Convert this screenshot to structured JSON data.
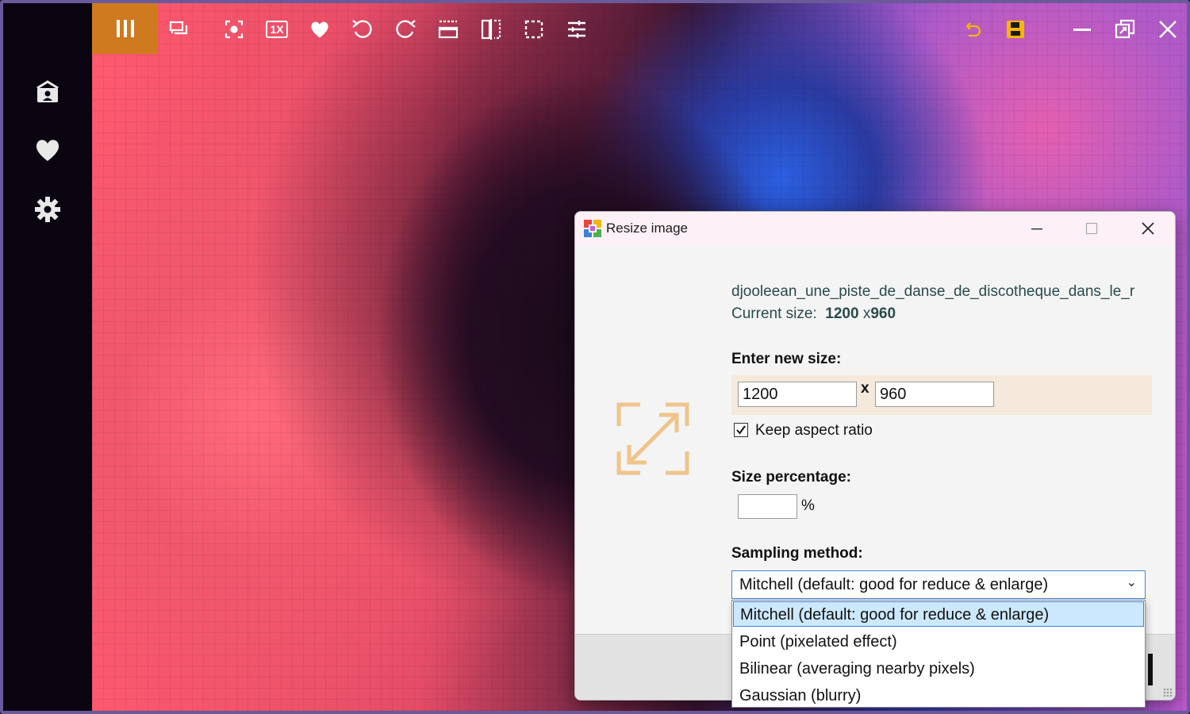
{
  "window": {
    "sidebar": {
      "items": [
        "contacts-card-icon",
        "heart-icon",
        "gear-icon"
      ]
    },
    "toolbar": {
      "menu_icon": "bars-icon",
      "zoom_label": "1X",
      "icons": [
        "chat-icon",
        "focus-icon",
        "1x-icon",
        "heart-icon",
        "rotate-left-icon",
        "rotate-right-icon",
        "flip-vertical-icon",
        "flip-horizontal-icon",
        "crop-icon",
        "adjust-icon"
      ],
      "right_icons": [
        "undo-icon",
        "save-icon",
        "minimize-icon",
        "restore-icon",
        "close-icon"
      ],
      "accent_color": "#cf7a1e",
      "save_color": "#f5b700"
    }
  },
  "dialog": {
    "title": "Resize image",
    "filename": "djooleean_une_piste_de_danse_de_discotheque_dans_le_r",
    "current_size_label": "Current size:",
    "current_width": "1200",
    "current_sep": " x",
    "current_height": "960",
    "new_size_label": "Enter new size:",
    "width_value": "1200",
    "x_separator": "x",
    "height_value": "960",
    "keep_aspect_label": "Keep aspect ratio",
    "keep_aspect_checked": true,
    "size_percentage_label": "Size percentage:",
    "percentage_value": "",
    "percent_sign": "%",
    "sampling_label": "Sampling method:",
    "sampling_selected": "Mitchell (default: good for reduce & enlarge)",
    "sampling_options": [
      "Mitchell (default: good for reduce & enlarge)",
      "Point (pixelated effect)",
      "Bilinear (averaging nearby pixels)",
      "Gaussian (blurry)"
    ],
    "icon_color": "#f0c48a"
  }
}
